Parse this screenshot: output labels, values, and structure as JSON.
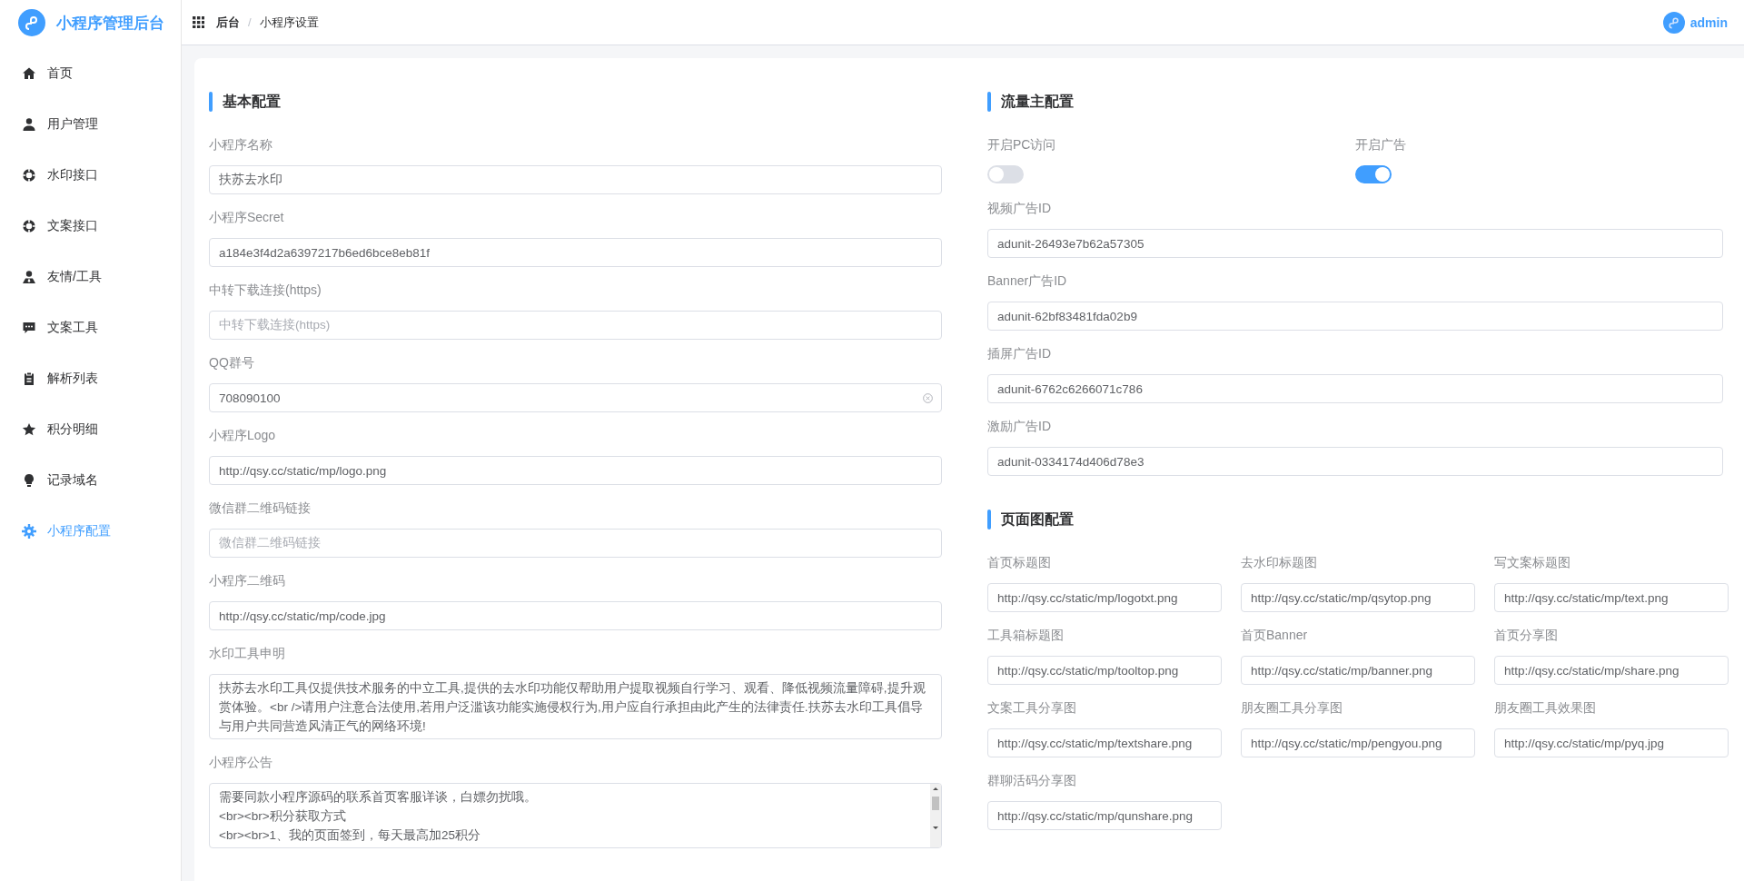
{
  "sidebar": {
    "title": "小程序管理后台",
    "items": [
      {
        "label": "首页",
        "selected": false
      },
      {
        "label": "用户管理",
        "selected": false
      },
      {
        "label": "水印接口",
        "selected": false
      },
      {
        "label": "文案接口",
        "selected": false
      },
      {
        "label": "友情/工具",
        "selected": false
      },
      {
        "label": "文案工具",
        "selected": false
      },
      {
        "label": "解析列表",
        "selected": false
      },
      {
        "label": "积分明细",
        "selected": false
      },
      {
        "label": "记录域名",
        "selected": false
      },
      {
        "label": "小程序配置",
        "selected": true
      }
    ]
  },
  "header": {
    "breadcrumb": [
      "后台",
      "小程序设置"
    ],
    "breadcrumb_separator": "/",
    "user": "admin"
  },
  "basic": {
    "title": "基本配置",
    "fields": [
      {
        "kind": "input",
        "label": "小程序名称",
        "value": "扶苏去水印"
      },
      {
        "kind": "input",
        "label": "小程序Secret",
        "value": "a184e3f4d2a6397217b6ed6bce8eb81f"
      },
      {
        "kind": "input",
        "label": "中转下载连接(https)",
        "placeholder": "中转下载连接(https)"
      },
      {
        "kind": "input",
        "label": "QQ群号",
        "value": "708090100",
        "clearable": true
      },
      {
        "kind": "input",
        "label": "小程序Logo",
        "value": "http://qsy.cc/static/mp/logo.png"
      },
      {
        "kind": "input",
        "label": "微信群二维码链接",
        "placeholder": "微信群二维码链接"
      },
      {
        "kind": "input",
        "label": "小程序二维码",
        "value": "http://qsy.cc/static/mp/code.jpg"
      },
      {
        "kind": "textarea",
        "label": "水印工具申明",
        "lines": [
          "扶苏去水印工具仅提供技术服务的中立工具,提供的去水印功能仅帮助用户提取视频自行学习、观看、降低视频流量障碍,提升观赏体验。<br />请用户注意合法使用,若用户泛滥该功能实施侵权行为,用户应自行承担由此产生的法律责任.扶苏去水印工具倡导与用户共同营造风清正气的网络环境!"
        ]
      },
      {
        "kind": "scrolltext",
        "label": "小程序公告",
        "lines": [
          "需要同款小程序源码的联系首页客服详谈，白嫖勿扰哦。",
          "<br><br>积分获取方式",
          "<br><br>1、我的页面签到，每天最高加25积分"
        ]
      }
    ]
  },
  "traffic": {
    "title": "流量主配置",
    "toggles": [
      {
        "label": "开启PC访问",
        "on": false
      },
      {
        "label": "开启广告",
        "on": true
      }
    ],
    "fields": [
      {
        "label": "视频广告ID",
        "value": "adunit-26493e7b62a57305"
      },
      {
        "label": "Banner广告ID",
        "value": "adunit-62bf83481fda02b9"
      },
      {
        "label": "插屏广告ID",
        "value": "adunit-6762c6266071c786"
      },
      {
        "label": "激励广告ID",
        "value": "adunit-0334174d406d78e3"
      }
    ]
  },
  "pages": {
    "title": "页面图配置",
    "fields": [
      {
        "label": "首页标题图",
        "value": "http://qsy.cc/static/mp/logotxt.png"
      },
      {
        "label": "去水印标题图",
        "value": "http://qsy.cc/static/mp/qsytop.png"
      },
      {
        "label": "写文案标题图",
        "value": "http://qsy.cc/static/mp/text.png"
      },
      {
        "label": "工具箱标题图",
        "value": "http://qsy.cc/static/mp/tooltop.png"
      },
      {
        "label": "首页Banner",
        "value": "http://qsy.cc/static/mp/banner.png"
      },
      {
        "label": "首页分享图",
        "value": "http://qsy.cc/static/mp/share.png"
      },
      {
        "label": "文案工具分享图",
        "value": "http://qsy.cc/static/mp/textshare.png"
      },
      {
        "label": "朋友圈工具分享图",
        "value": "http://qsy.cc/static/mp/pengyou.png"
      },
      {
        "label": "朋友圈工具效果图",
        "value": "http://qsy.cc/static/mp/pyq.jpg"
      },
      {
        "label": "群聊活码分享图",
        "value": "http://qsy.cc/static/mp/qunshare.png"
      }
    ]
  }
}
